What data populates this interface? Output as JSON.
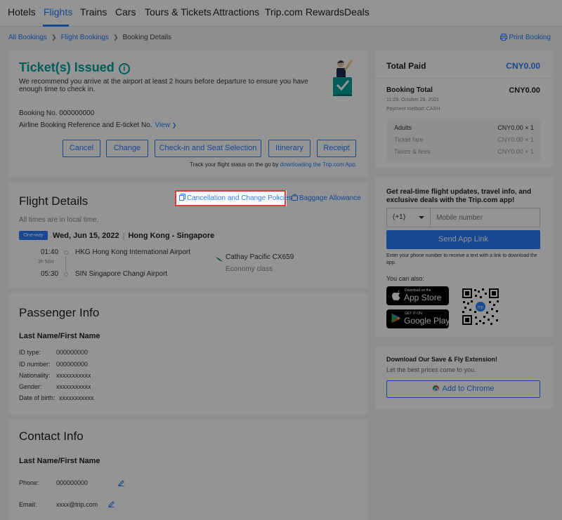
{
  "nav": {
    "items": [
      "Hotels",
      "Flights",
      "Trains",
      "Cars",
      "Tours & Tickets",
      "Attractions",
      "Trip.com Rewards",
      "Deals"
    ],
    "active": "Flights"
  },
  "breadcrumb": {
    "items": [
      "All Bookings",
      "Flight Bookings",
      "Booking Details"
    ],
    "print": "Print Booking"
  },
  "ticket": {
    "title": "Ticket(s) Issued",
    "note": "We recommend you arrive at the airport at least 2 hours before departure to ensure you have enough time to check in.",
    "booking_no": "Booking No. 000000000",
    "airline_ref": "Airline Booking Reference and E-ticket No.",
    "view_link": "View",
    "buttons": {
      "cancel": "Cancel",
      "change": "Change",
      "checkin": "Check-in and Seat Selection",
      "itinerary": "Itinerary",
      "receipt": "Receipt"
    },
    "track_prefix": "Track your flight status on the go by",
    "track_link": "downloading the Trip.com App."
  },
  "flight": {
    "title": "Flight Details",
    "policies": "Cancellation and Change Policies",
    "baggage": "Baggage Allowance",
    "local_time": "All times are in local time.",
    "badge": "One-way",
    "date": "Wed, Jun 15, 2022",
    "route": "Hong Kong - Singapore",
    "depart_time": "01:40",
    "depart_airport": "HKG  Hong Kong International Airport",
    "duration": "3h 50m",
    "arrive_time": "05:30",
    "arrive_airport": "SIN  Singapore Changi Airport",
    "airline": "Cathay Pacific CX659",
    "cabin": "Economy class"
  },
  "passenger": {
    "title": "Passenger Info",
    "name_label": "Last Name/First Name",
    "fields": [
      {
        "label": "ID type:",
        "value": "000000000"
      },
      {
        "label": "ID number:",
        "value": "000000000"
      },
      {
        "label": "Nationality:",
        "value": "xxxxxxxxxxx"
      },
      {
        "label": "Gender:",
        "value": "xxxxxxxxxxx"
      },
      {
        "label": "Date of birth:",
        "value": "xxxxxxxxxxx"
      }
    ]
  },
  "contact": {
    "title": "Contact Info",
    "name_label": "Last Name/First Name",
    "phone_label": "Phone:",
    "phone": "000000000",
    "email_label": "Email:",
    "email": "xxxx@trip.com"
  },
  "summary": {
    "total_paid_label": "Total Paid",
    "total_paid": "CNY0.00",
    "booking_total_label": "Booking Total",
    "booking_total": "CNY0.00",
    "booking_date": "11:29, October 28, 2021",
    "payment_method": "Payment method: CASH",
    "rows": [
      {
        "label": "Adults",
        "value": "CNY0.00 × 1"
      },
      {
        "label": "Ticket fare",
        "value": "CNY0.00 × 1"
      },
      {
        "label": "Taxes & fees",
        "value": "CNY0.00 × 1"
      }
    ]
  },
  "app": {
    "headline": "Get real-time flight updates, travel info, and exclusive deals with the Trip.com app!",
    "country_code": "(+1)",
    "phone_placeholder": "Mobile number",
    "send": "Send App Link",
    "sms_note": "Enter your phone number to receive a text with a link to download the app.",
    "you_can": "You can also:",
    "appstore_small": "Download on the",
    "appstore_big": "App Store",
    "googleplay_small": "GET IT ON",
    "googleplay_big": "Google Play"
  },
  "extension": {
    "title": "Download Our Save & Fly Extension!",
    "sub": "Let the best prices come to you.",
    "button": "Add to Chrome"
  },
  "colors": {
    "accent": "#287dfa",
    "teal": "#00a19b",
    "highlight": "#e53935"
  }
}
